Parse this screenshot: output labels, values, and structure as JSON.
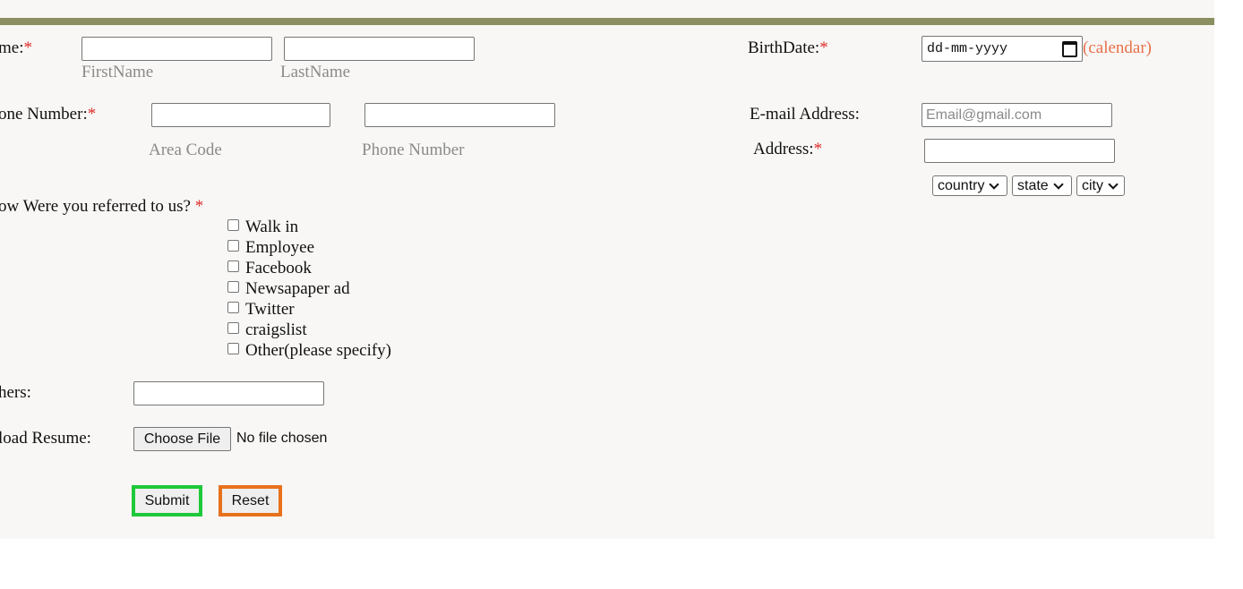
{
  "form": {
    "name": {
      "label": "me:",
      "required_mark": "*",
      "first_value": "",
      "last_value": "",
      "first_caption": "FirstName",
      "last_caption": "LastName"
    },
    "phone": {
      "label": "one Number:",
      "required_mark": "*",
      "area_value": "",
      "number_value": "",
      "area_caption": "Area Code",
      "number_caption": "Phone Number"
    },
    "referral": {
      "label": "ow Were you referred to us?",
      "required_mark": "*",
      "options": [
        {
          "label": "Walk in",
          "checked": false
        },
        {
          "label": "Employee",
          "checked": false
        },
        {
          "label": "Facebook",
          "checked": false
        },
        {
          "label": "Newsapaper ad",
          "checked": false
        },
        {
          "label": "Twitter",
          "checked": false
        },
        {
          "label": "craigslist",
          "checked": false
        },
        {
          "label": "Other(please specify)",
          "checked": false
        }
      ]
    },
    "others": {
      "label": "hers:",
      "value": ""
    },
    "resume": {
      "label": "load Resume:",
      "button_label": "Choose File",
      "status": "No file chosen"
    },
    "birthdate": {
      "label": "BirthDate:",
      "required_mark": "*",
      "placeholder": "dd-mm-yyyy",
      "calendar_link": "(calendar)"
    },
    "email": {
      "label": "E-mail Address:",
      "value": "",
      "placeholder": "Email@gmail.com"
    },
    "address": {
      "label": "Address:",
      "required_mark": "*",
      "value": ""
    },
    "location_selects": {
      "country": "country",
      "state": "state",
      "city": "city"
    },
    "buttons": {
      "submit": "Submit",
      "reset": "Reset"
    }
  },
  "colors": {
    "top_bar": "#8c8f62",
    "required": "#e0302f",
    "calendar_link": "#e8704a",
    "submit_border": "#1dc93a",
    "reset_border": "#e8711c",
    "panel_background": "#f8f7f5"
  }
}
